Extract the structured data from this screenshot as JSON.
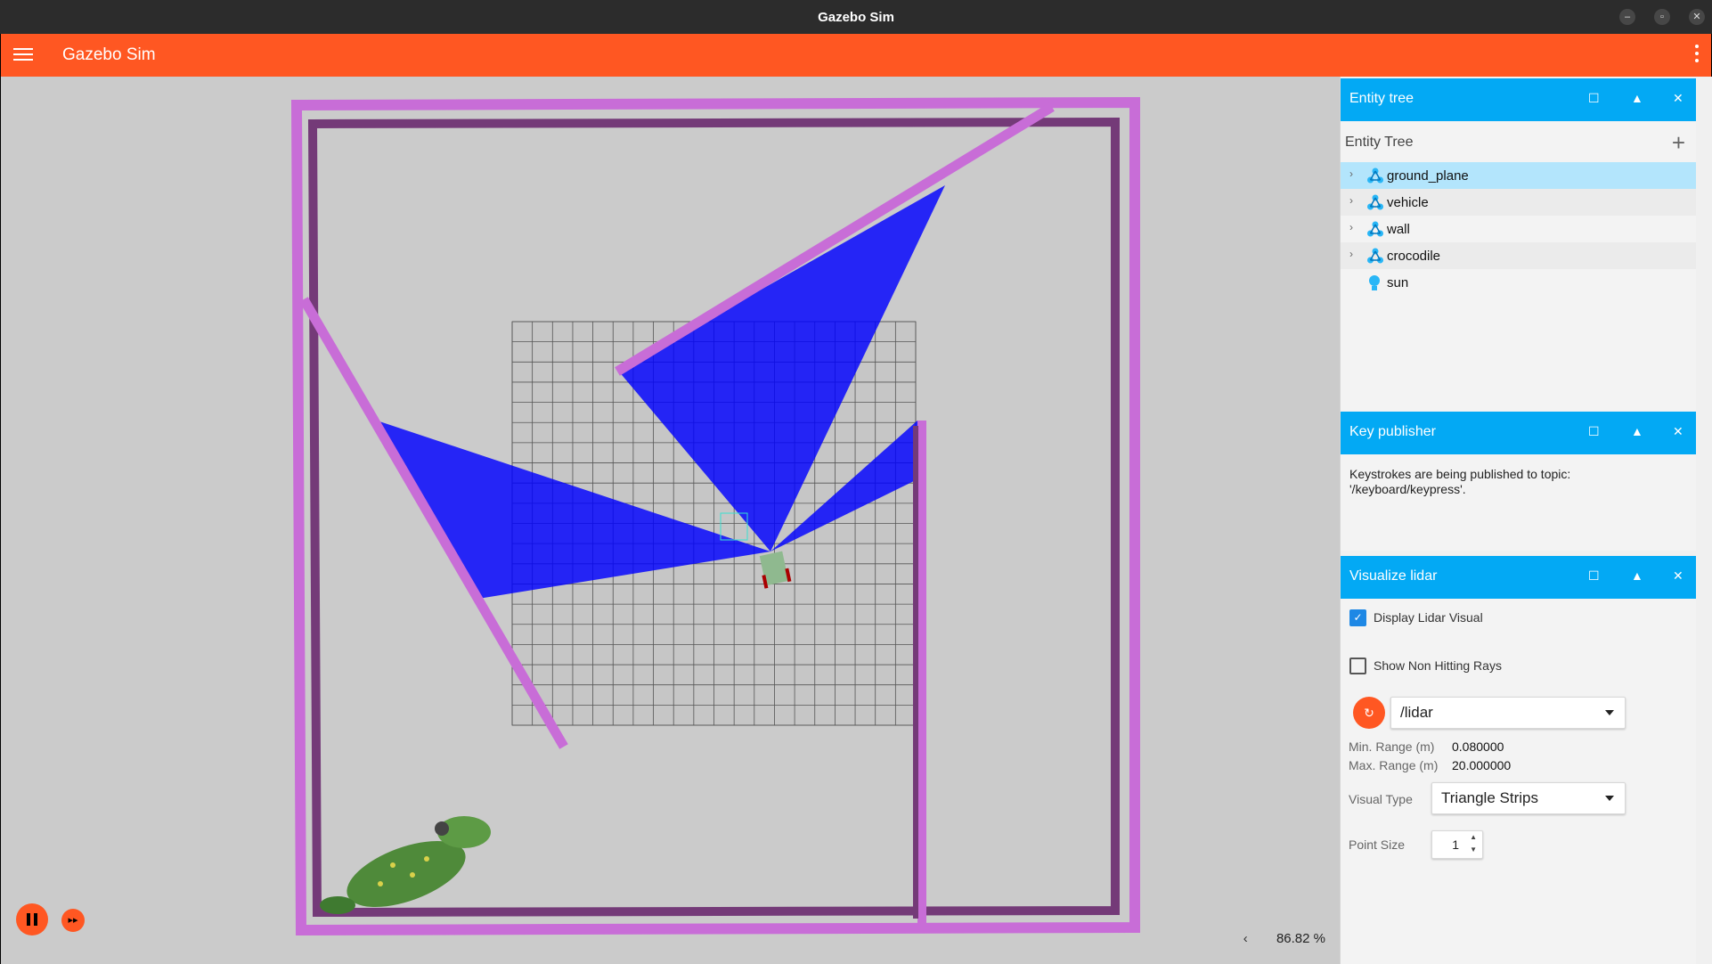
{
  "window": {
    "title": "Gazebo Sim",
    "minimize_icon": "minimize-icon",
    "restore_icon": "restore-icon",
    "close_icon": "close-icon"
  },
  "appbar": {
    "title": "Gazebo Sim",
    "menu_icon": "hamburger-icon",
    "options_icon": "kebab-icon"
  },
  "scene": {
    "zoom_label": "86.82 %",
    "collapse_glyph": "‹",
    "controls": {
      "play_pause_icon": "pause-icon",
      "step_icon": "fast-forward-icon"
    }
  },
  "entity_tree_panel": {
    "title": "Entity tree",
    "header_label": "Entity Tree",
    "add_glyph": "+",
    "items": [
      {
        "label": "ground_plane",
        "icon": "model-icon",
        "expandable": true,
        "selected": true
      },
      {
        "label": "vehicle",
        "icon": "model-icon",
        "expandable": true,
        "selected": false
      },
      {
        "label": "wall",
        "icon": "model-icon",
        "expandable": true,
        "selected": false
      },
      {
        "label": "crocodile",
        "icon": "model-icon",
        "expandable": true,
        "selected": false
      },
      {
        "label": "sun",
        "icon": "light-icon",
        "expandable": false,
        "selected": false
      }
    ]
  },
  "key_publisher_panel": {
    "title": "Key publisher",
    "message_line1": "Keystrokes are being published to topic:",
    "message_line2": "'/keyboard/keypress'."
  },
  "visualize_lidar_panel": {
    "title": "Visualize lidar",
    "display_lidar_label": "Display Lidar Visual",
    "display_lidar_checked": true,
    "non_hitting_label": "Show Non Hitting Rays",
    "non_hitting_checked": false,
    "topic": "/lidar",
    "min_range_label": "Min. Range (m)",
    "min_range_value": "0.080000",
    "max_range_label": "Max. Range (m)",
    "max_range_value": "20.000000",
    "visual_type_label": "Visual Type",
    "visual_type_value": "Triangle Strips",
    "point_size_label": "Point Size",
    "point_size_value": "1"
  },
  "colors": {
    "app_accent": "#ff5722",
    "panel_header": "#03a9f4",
    "selection": "#b3e5fc",
    "wall": "#c86dd7",
    "lidar": "#0000ff"
  }
}
